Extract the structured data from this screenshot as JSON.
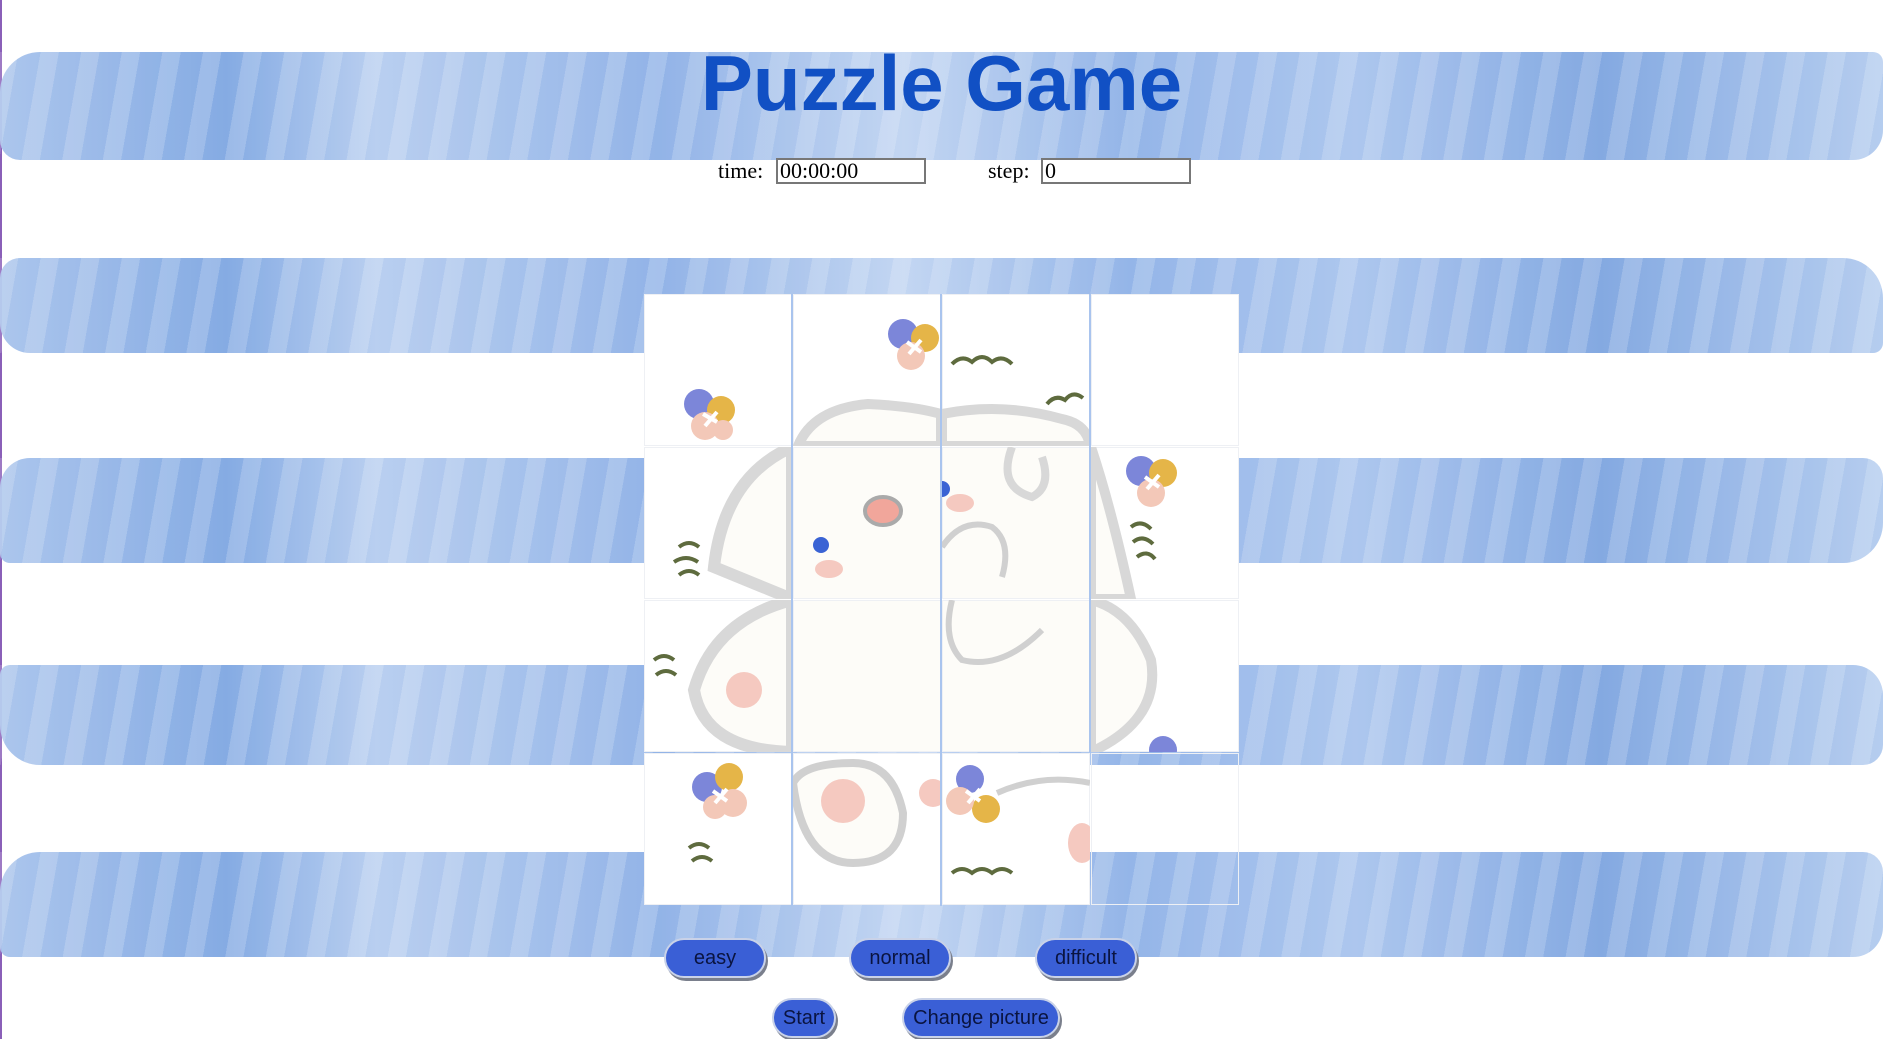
{
  "title": "Puzzle Game",
  "stats": {
    "time_label": "time:",
    "time_value": "00:00:00",
    "step_label": "step:",
    "step_value": "0"
  },
  "difficulty": {
    "easy": "easy",
    "normal": "normal",
    "difficult": "difficult"
  },
  "actions": {
    "start": "Start",
    "change_picture": "Change picture"
  },
  "board": {
    "grid": "4x4",
    "empty_slot": "row 4, column 4"
  },
  "colors": {
    "title": "#1150c4",
    "button": "#3a5fd6",
    "stripes": "#8db0e6"
  }
}
